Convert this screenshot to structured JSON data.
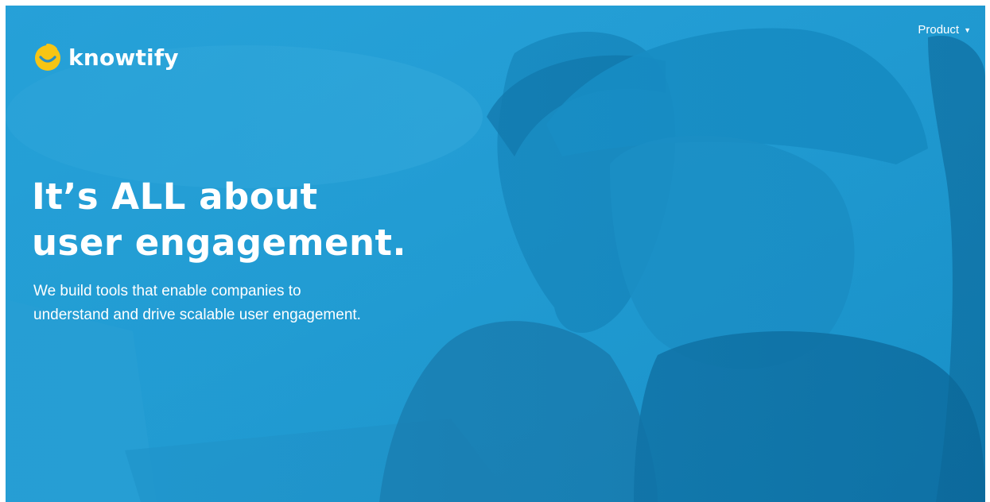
{
  "brand": {
    "name": "knowtify",
    "logo_icon": "smiley-icon"
  },
  "nav": {
    "product_label": "Product",
    "caret_icon": "chevron-down-icon"
  },
  "hero": {
    "headline_line1": "It’s ALL about",
    "headline_line2": "user engagement.",
    "subtext_line1": "We build tools that enable companies to",
    "subtext_line2": "understand and drive scalable user engagement."
  },
  "colors": {
    "overlay_blue": "#1f99cf",
    "logo_yellow": "#f7c514",
    "text": "#ffffff"
  }
}
